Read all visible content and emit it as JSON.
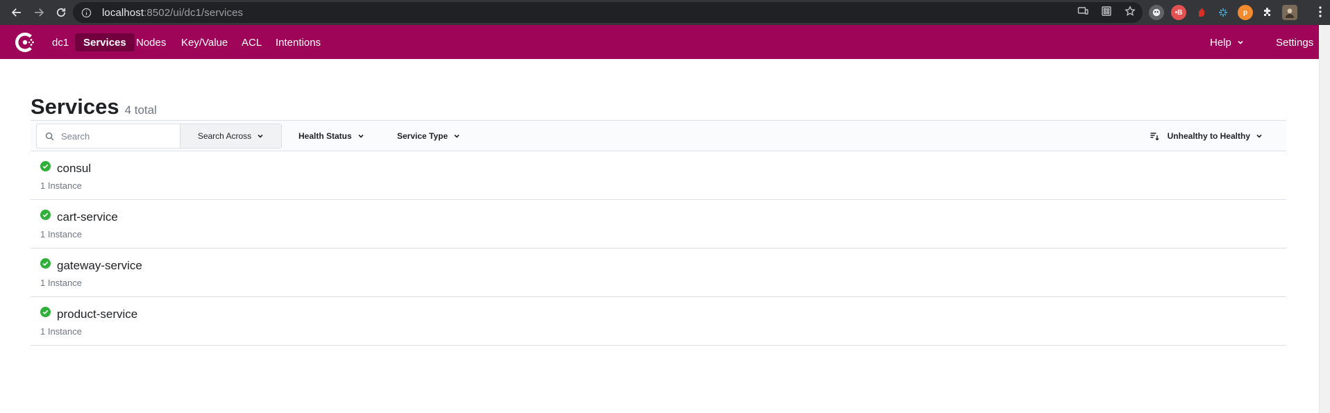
{
  "browser": {
    "url_host": "localhost",
    "url_rest": ":8502/ui/dc1/services",
    "extensions": [
      {
        "icon": "ghost-extension-icon",
        "color": "#5f6368",
        "label": ""
      },
      {
        "icon": "toggl-extension-icon",
        "color": "#e25252",
        "label": "•B"
      },
      {
        "icon": "hand-extension-icon",
        "color": "#d93025",
        "label": ""
      },
      {
        "icon": "sparkle-extension-icon",
        "color": "#4fc3f7",
        "label": ""
      },
      {
        "icon": "p-extension-icon",
        "color": "#f28b30",
        "label": "p"
      }
    ]
  },
  "header": {
    "datacenter": "dc1",
    "nav": [
      "Services",
      "Nodes",
      "Key/Value",
      "ACL",
      "Intentions"
    ],
    "active": "Services",
    "help": "Help",
    "settings": "Settings",
    "brand_color": "#9e0458"
  },
  "page": {
    "title": "Services",
    "count": "4 total"
  },
  "toolbar": {
    "search_placeholder": "Search",
    "search_across": "Search Across",
    "health_status": "Health Status",
    "service_type": "Service Type",
    "sort": "Unhealthy to Healthy"
  },
  "services": [
    {
      "name": "consul",
      "instances": "1 Instance",
      "status": "passing"
    },
    {
      "name": "cart-service",
      "instances": "1 Instance",
      "status": "passing"
    },
    {
      "name": "gateway-service",
      "instances": "1 Instance",
      "status": "passing"
    },
    {
      "name": "product-service",
      "instances": "1 Instance",
      "status": "passing"
    }
  ]
}
